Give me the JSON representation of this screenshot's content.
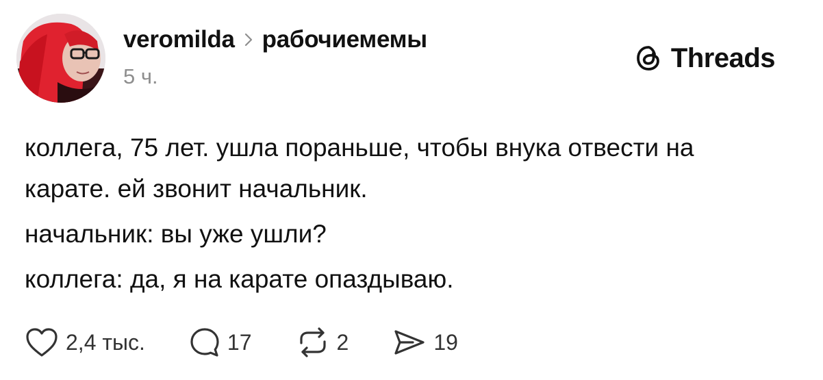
{
  "post": {
    "author": {
      "username": "veromilda",
      "avatar_icon": "avatar-photo"
    },
    "community": "рабочиемемы",
    "timestamp": "5 ч.",
    "brand": {
      "name": "Threads",
      "icon": "threads-logo-icon"
    },
    "paragraphs": [
      "коллега, 75 лет. ушла пораньше, чтобы внука отвести на карате. ей звонит начальник.",
      "начальник: вы уже ушли?",
      "коллега: да, я на карате опаздываю."
    ],
    "actions": {
      "likes": "2,4 тыс.",
      "replies": "17",
      "reposts": "2",
      "shares": "19"
    }
  },
  "colors": {
    "text": "#111111",
    "muted": "#8e8e8e",
    "background": "#ffffff"
  }
}
